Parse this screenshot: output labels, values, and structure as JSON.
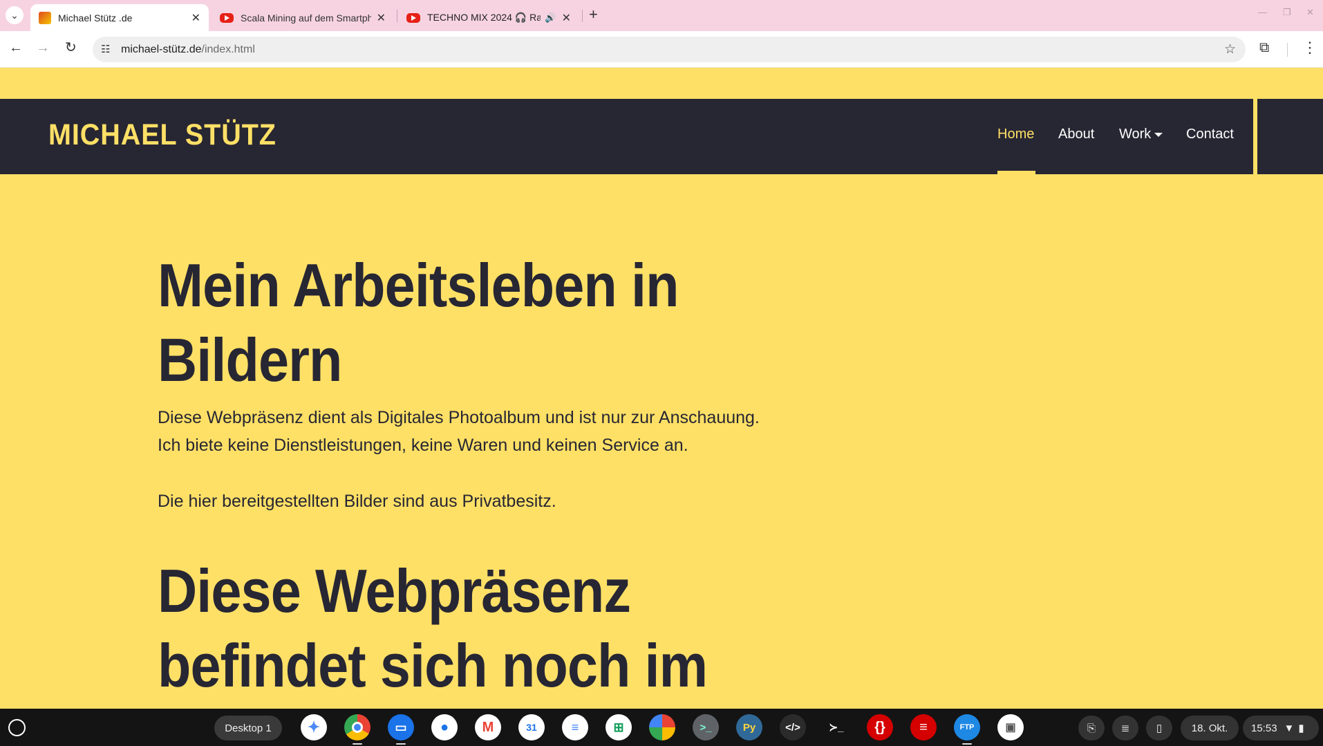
{
  "browser": {
    "tabs": [
      {
        "title": "Michael Stütz .de",
        "active": true
      },
      {
        "title": "Scala Mining auf dem Smartph",
        "active": false
      },
      {
        "title": "TECHNO MIX 2024 🎧 Rav",
        "active": false
      }
    ],
    "url_host": "michael-stütz.de",
    "url_path": "/index.html"
  },
  "site": {
    "brand": "MICHAEL STÜTZ",
    "nav": [
      {
        "label": "Home",
        "active": true
      },
      {
        "label": "About",
        "active": false
      },
      {
        "label": "Work",
        "active": false
      },
      {
        "label": "Contact",
        "active": false
      }
    ],
    "heading1_line1": "Mein Arbeitsleben in",
    "heading1_line2": "Bildern",
    "intro_line1": "Diese Webpräsenz dient als Digitales Photoalbum und ist nur zur Anschauung.",
    "intro_line2": "Ich biete keine Dienstleistungen, keine Waren und keinen Service an.",
    "intro_line3": "Die hier bereitgestellten Bilder sind aus Privatbesitz.",
    "heading2_line1": "Diese Webpräsenz",
    "heading2_line2": "befindet sich noch im"
  },
  "colors": {
    "accent": "#ffe066",
    "nav_bg": "#272633",
    "text": "#272633"
  },
  "shelf": {
    "desk_label": "Desktop 1",
    "date": "18. Okt.",
    "time": "15:53",
    "apps": [
      "gemini-icon",
      "chrome-icon",
      "files-icon",
      "messages-icon",
      "gmail-icon",
      "calendar-icon",
      "docs-icon",
      "sheets-icon",
      "photos-icon",
      "terminal-icon",
      "python-icon",
      "code-icon",
      "shell-icon",
      "json-icon",
      "text-icon",
      "ftp-icon",
      "gallery-icon"
    ],
    "calendar_day": "31",
    "python_label": "Py",
    "ftp_label": "FTP"
  }
}
